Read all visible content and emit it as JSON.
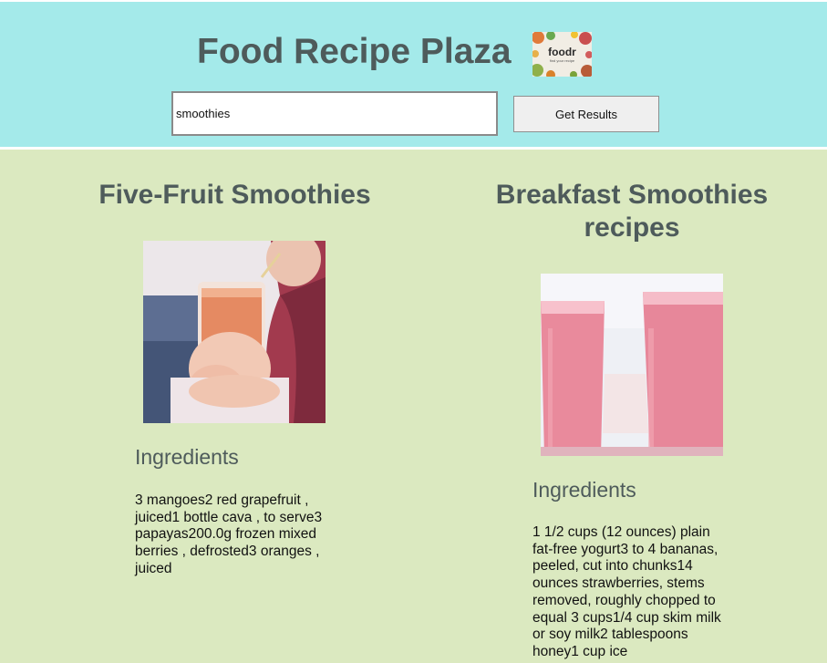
{
  "header": {
    "title": "Food Recipe Plaza",
    "logo_text": "foodr",
    "logo_subtext": "find your recipe"
  },
  "search": {
    "value": "smoothies",
    "button_label": "Get Results"
  },
  "recipes": [
    {
      "title": "Five-Fruit Smoothies",
      "ingredients_heading": "Ingredients",
      "ingredients": "3 mangoes2 red grapefruit , juiced1 bottle cava , to serve3 papayas200.0g frozen mixed berries , defrosted3 oranges , juiced"
    },
    {
      "title": "Breakfast Smoothies recipes",
      "ingredients_heading": "Ingredients",
      "ingredients": "1 1/2 cups (12 ounces) plain fat-free yogurt3 to 4 bananas, peeled, cut into chunks14 ounces strawberries, stems removed, roughly chopped to equal 3 cups1/4 cup skim milk or soy milk2 tablespoons honey1 cup ice"
    }
  ],
  "colors": {
    "header_bg": "#a4eaea",
    "page_bg": "#dbe9c0",
    "heading_text": "#4e5b5b"
  }
}
